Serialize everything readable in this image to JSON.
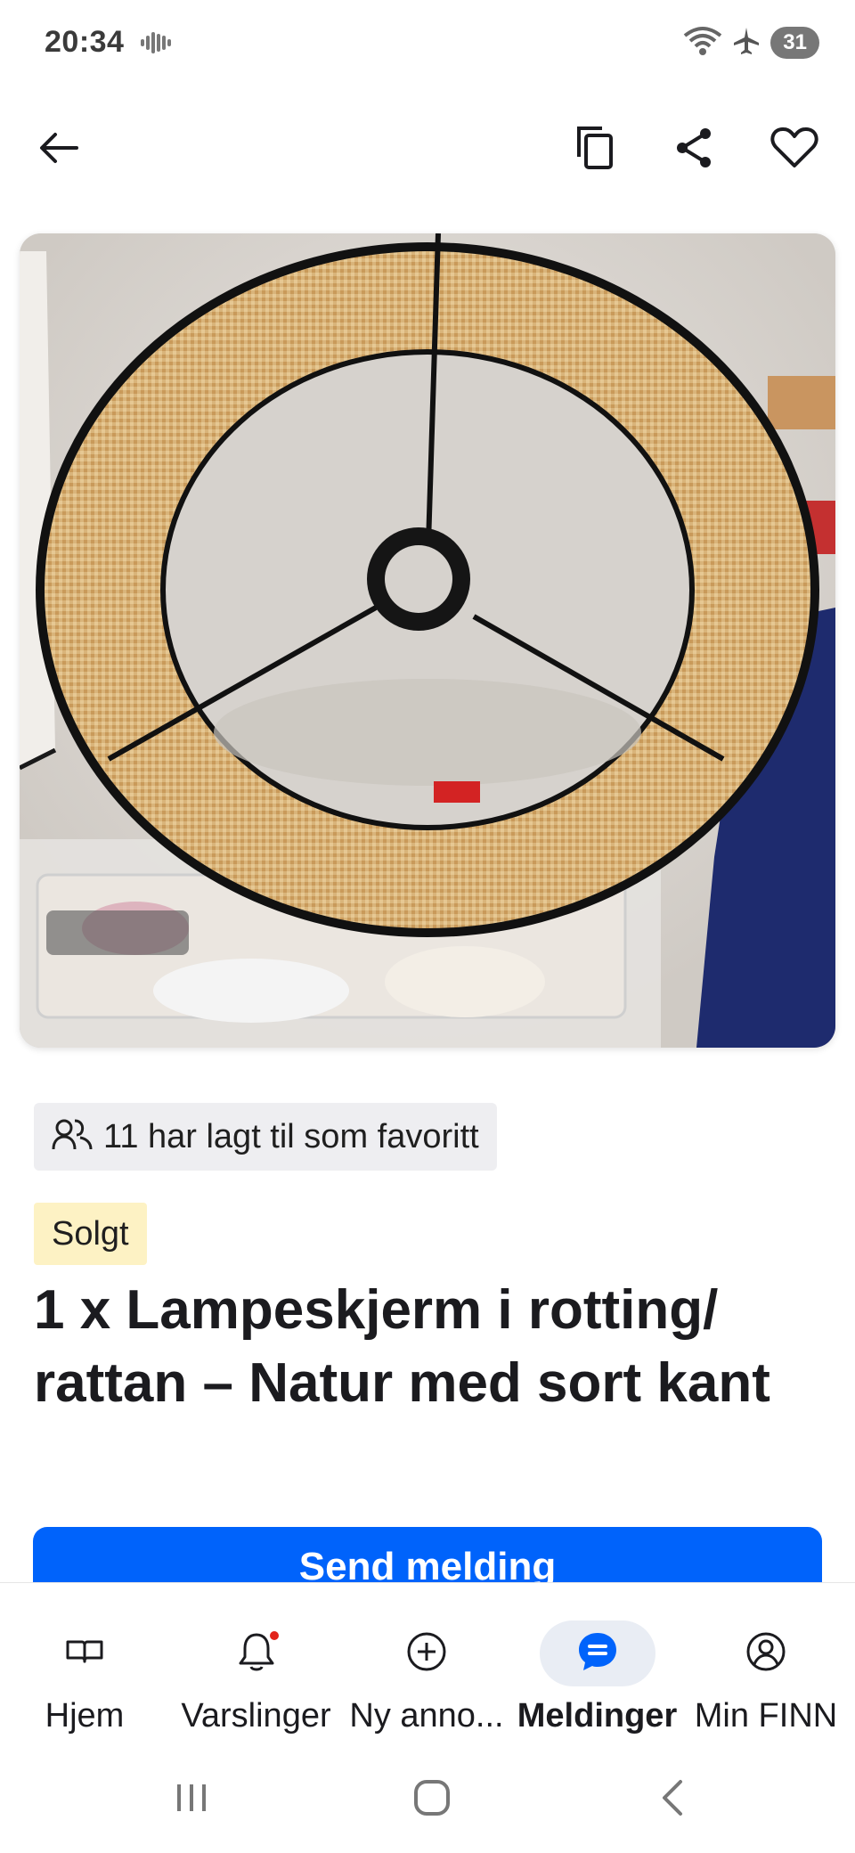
{
  "status_bar": {
    "time": "20:34",
    "battery": "31"
  },
  "app_bar": {
    "back_icon": "arrow-left-icon",
    "copy_icon": "copy-icon",
    "share_icon": "share-icon",
    "favorite_icon": "heart-icon"
  },
  "listing": {
    "favorites_text": "11 har lagt til som favoritt",
    "status_badge": "Solgt",
    "title": "1 x Lampeskjerm i rotting/ rattan – Natur med sort kant",
    "send_message_label": "Send melding"
  },
  "bottom_nav": {
    "items": [
      {
        "label": "Hjem",
        "icon": "book-icon",
        "active": false
      },
      {
        "label": "Varslinger",
        "icon": "bell-icon",
        "active": false
      },
      {
        "label": "Ny anno...",
        "icon": "plus-circle-icon",
        "active": false
      },
      {
        "label": "Meldinger",
        "icon": "chat-icon",
        "active": true
      },
      {
        "label": "Min FINN",
        "icon": "user-circle-icon",
        "active": false
      }
    ]
  },
  "colors": {
    "primary": "#0063fb",
    "sold_badge_bg": "#fdf2c4",
    "chip_bg": "#eeeef1",
    "notification_dot": "#e2231a"
  }
}
